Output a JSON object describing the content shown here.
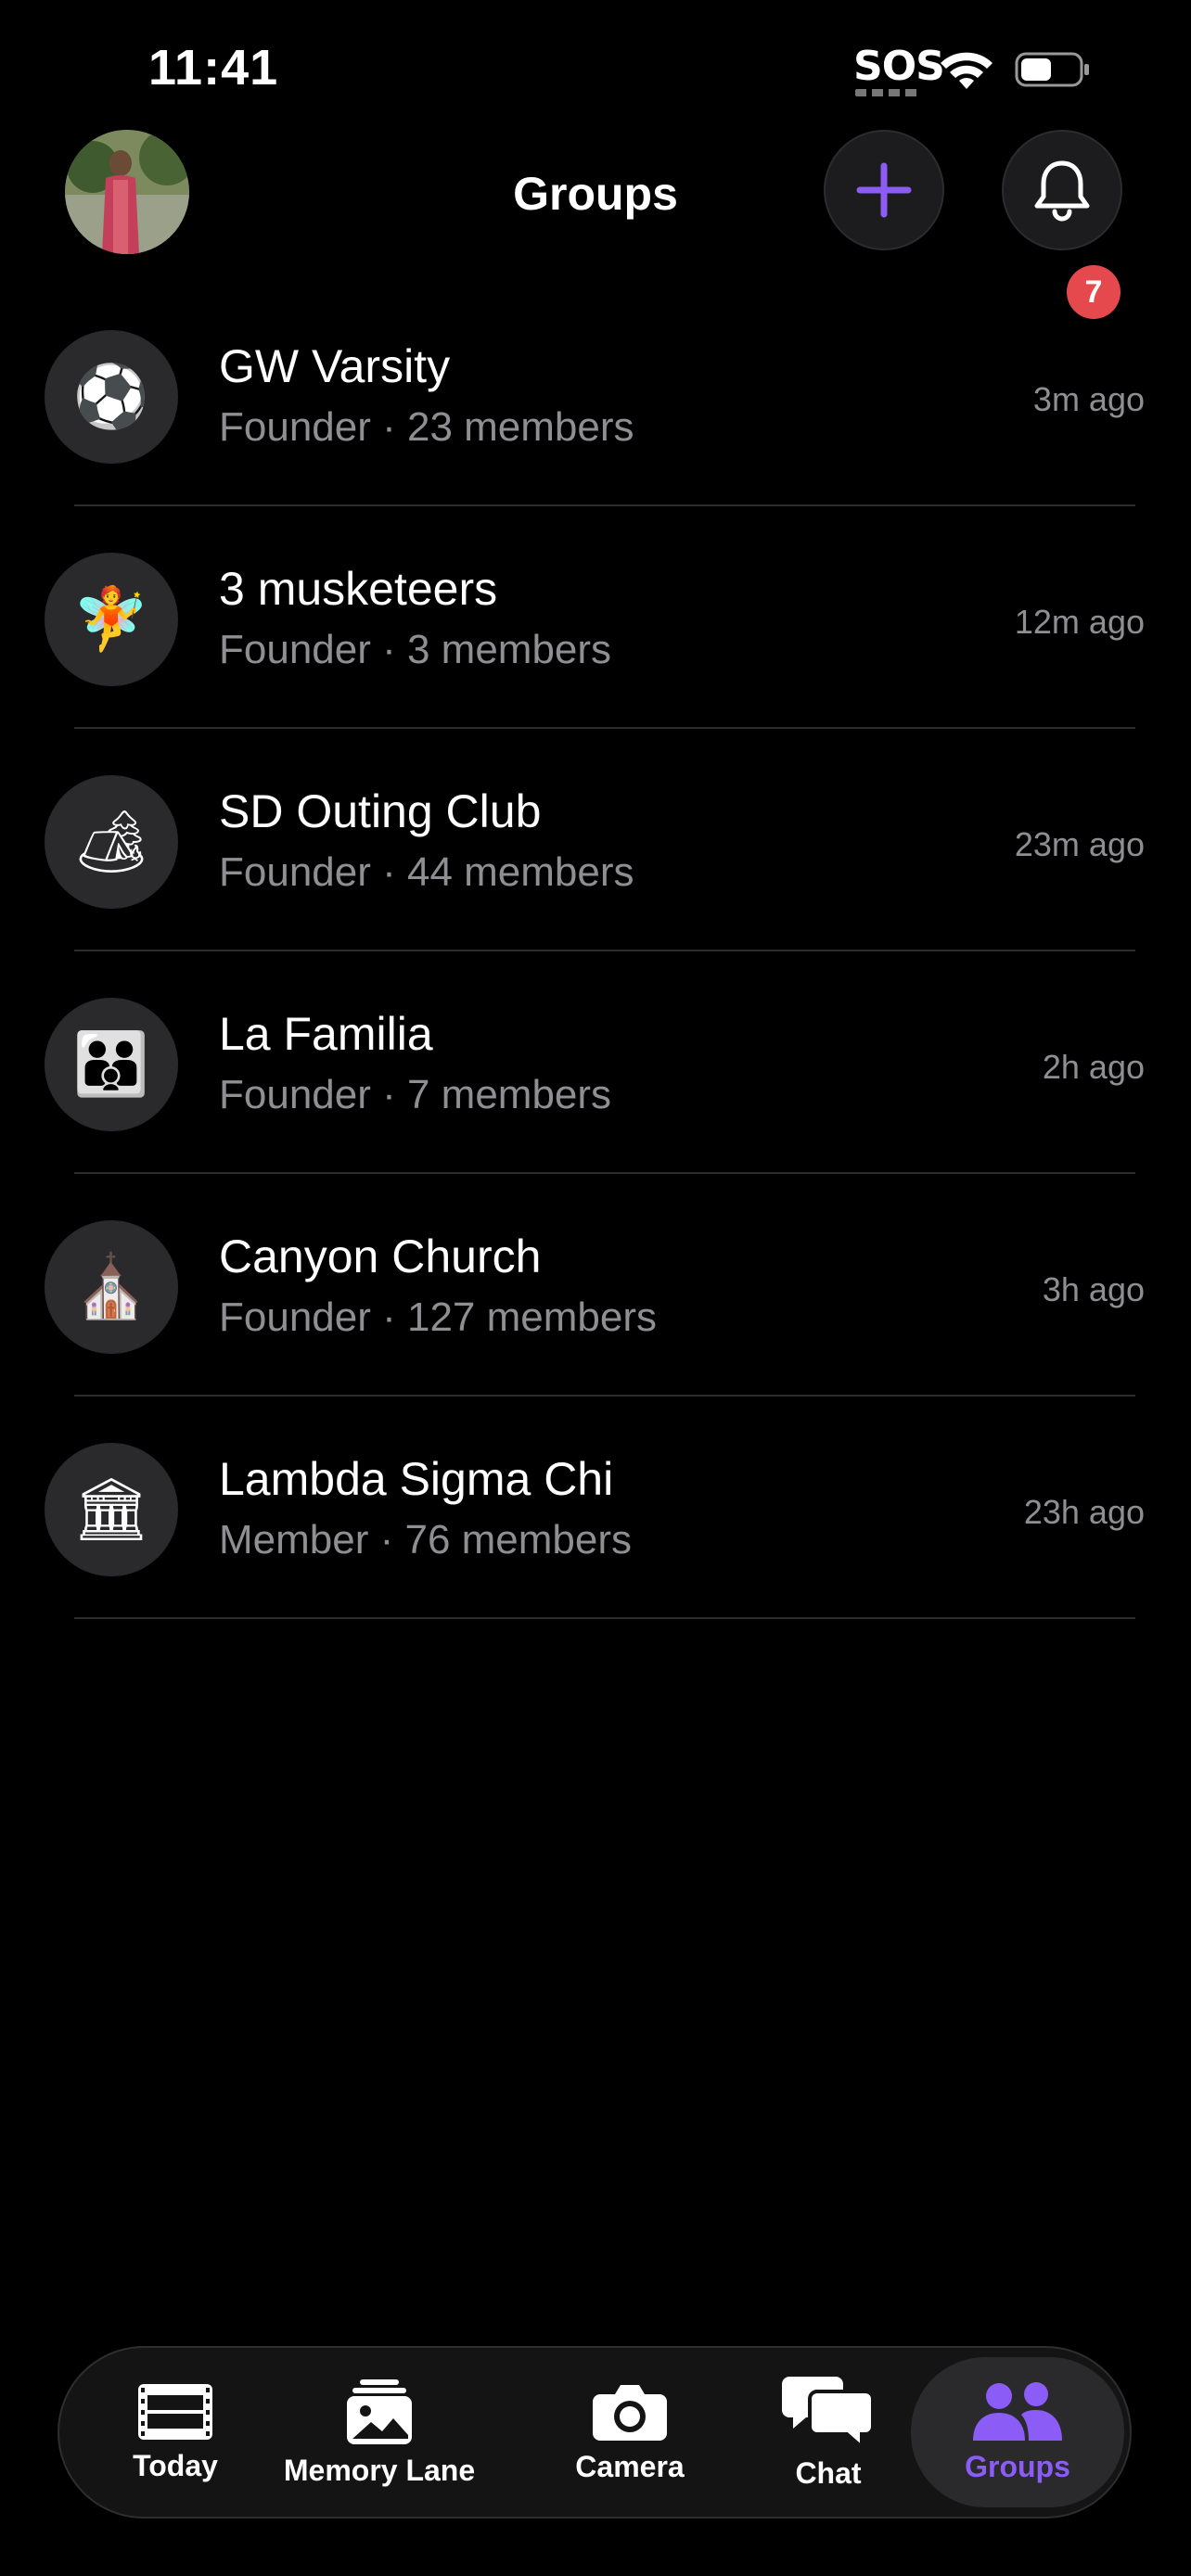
{
  "status_bar": {
    "time": "11:41",
    "sos": "SOS"
  },
  "header": {
    "title": "Groups",
    "notification_count": "7"
  },
  "groups": [
    {
      "name": "GW Varsity",
      "meta": "Founder · 23 members",
      "time": "3m ago",
      "emoji": "⚽",
      "icon_name": "soccer-ball-icon"
    },
    {
      "name": "3 musketeers",
      "meta": "Founder · 3 members",
      "time": "12m ago",
      "emoji": "🧚",
      "icon_name": "fairy-icon"
    },
    {
      "name": "SD Outing Club",
      "meta": "Founder · 44 members",
      "time": "23m ago",
      "emoji": "🏕",
      "icon_name": "camping-icon"
    },
    {
      "name": "La Familia",
      "meta": "Founder · 7 members",
      "time": "2h ago",
      "emoji": "👪",
      "icon_name": "family-icon"
    },
    {
      "name": "Canyon Church",
      "meta": "Founder · 127 members",
      "time": "3h ago",
      "emoji": "⛪",
      "icon_name": "church-icon"
    },
    {
      "name": "Lambda Sigma Chi",
      "meta": "Member · 76 members",
      "time": "23h ago",
      "emoji": "🏛",
      "icon_name": "classical-building-icon"
    }
  ],
  "tabs": [
    {
      "label": "Today",
      "icon": "film-strip-icon"
    },
    {
      "label": "Memory Lane",
      "icon": "photo-stack-icon"
    },
    {
      "label": "Camera",
      "icon": "camera-icon"
    },
    {
      "label": "Chat",
      "icon": "chat-bubbles-icon"
    },
    {
      "label": "Groups",
      "icon": "people-icon",
      "active": true
    }
  ],
  "colors": {
    "accent": "#8b5cf6",
    "badge": "#e5484d",
    "background": "#000000",
    "secondary_text": "#8e8e93"
  }
}
